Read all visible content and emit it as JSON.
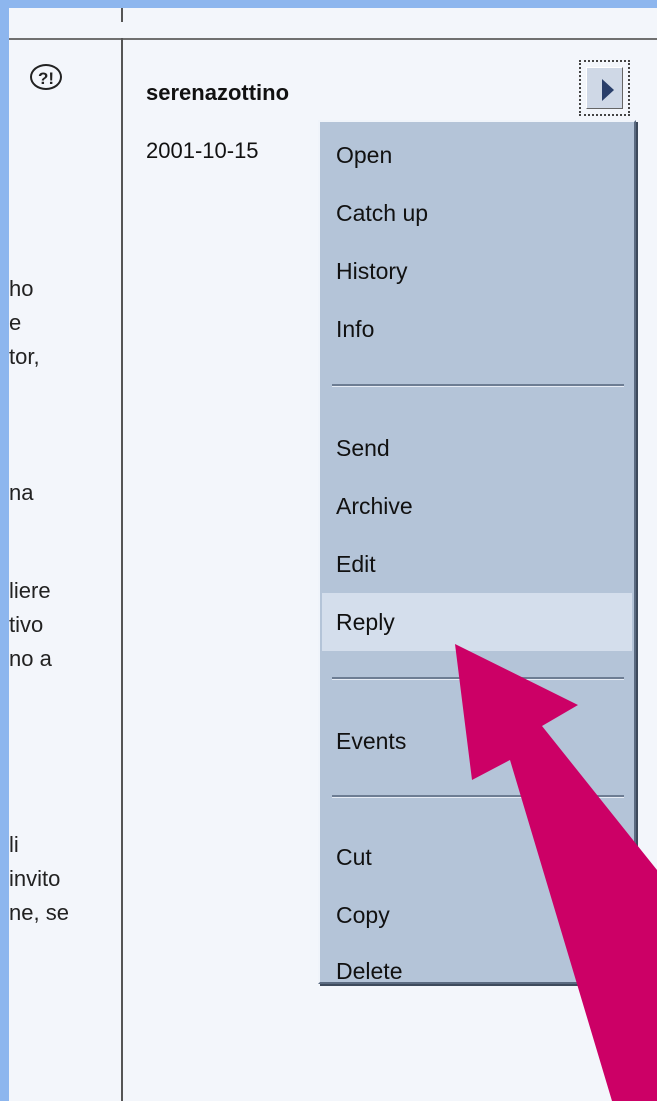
{
  "message": {
    "author": "serenazottino",
    "date": "2001-10-15"
  },
  "left_text_fragments": [
    "ho",
    "e",
    "tor,",
    "na",
    "liere",
    "tivo",
    "no a",
    "li",
    "invito",
    "ne, se"
  ],
  "context_menu": {
    "items": [
      "Open",
      "Catch up",
      "History",
      "Info",
      "Send",
      "Archive",
      "Edit",
      "Reply",
      "Events",
      "Cut",
      "Copy",
      "Delete"
    ],
    "highlighted": "Reply"
  },
  "colors": {
    "frame": "#8db6ee",
    "menu_background": "#b4c4d8",
    "menu_hover": "#d4deec",
    "annotation_arrow": "#cc0066"
  },
  "icons": {
    "status_icon": "question-exclamation-icon",
    "menu_button_icon": "triangle-right-icon"
  }
}
